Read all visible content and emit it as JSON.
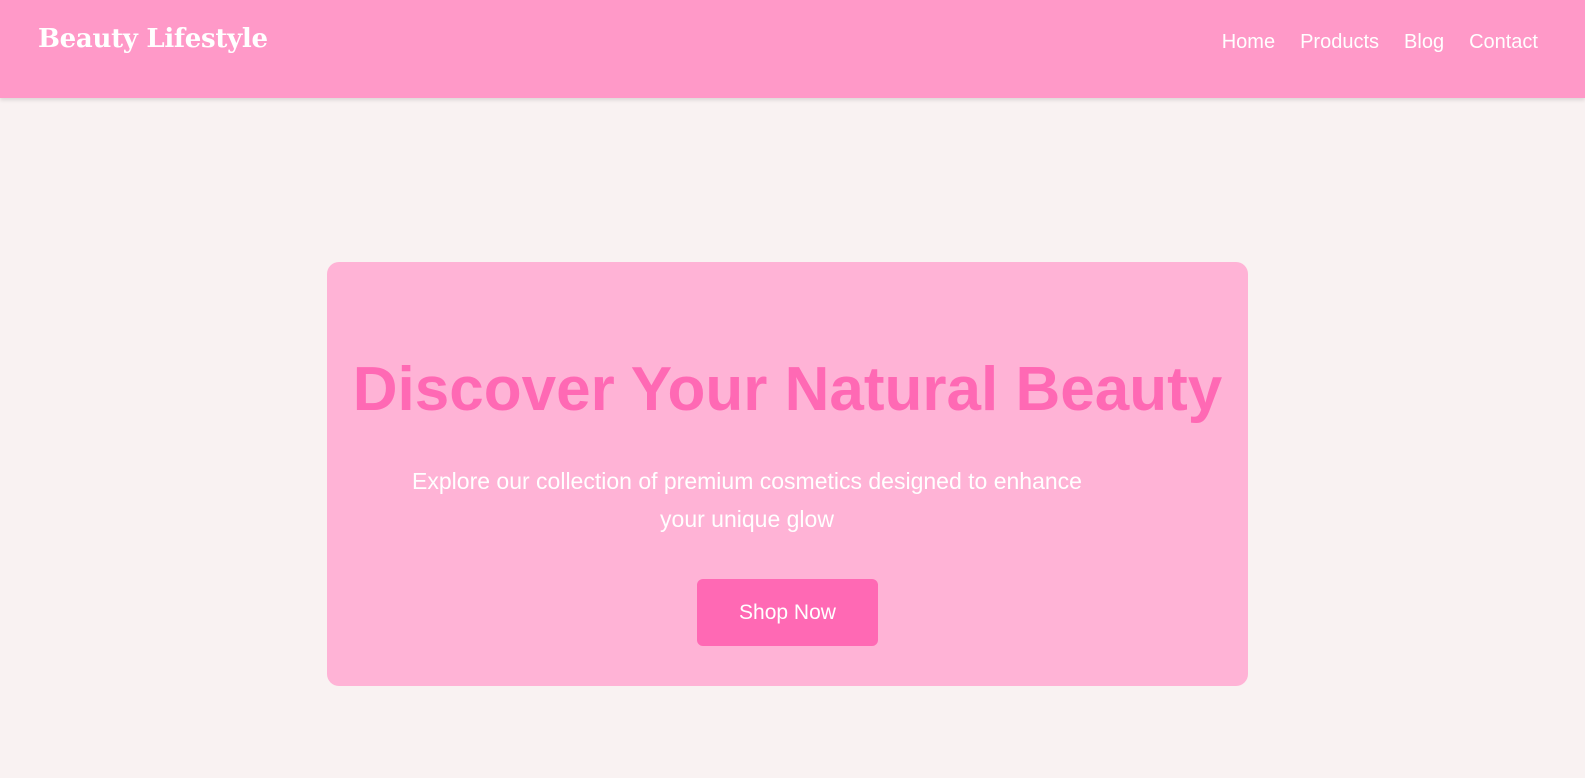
{
  "header": {
    "brand": "Beauty Lifestyle",
    "nav": [
      {
        "label": "Home"
      },
      {
        "label": "Products"
      },
      {
        "label": "Blog"
      },
      {
        "label": "Contact"
      }
    ]
  },
  "hero": {
    "title": "Discover Your Natural Beauty",
    "description": "Explore our collection of premium cosmetics designed to enhance your unique glow",
    "cta_label": "Shop Now"
  },
  "colors": {
    "header_bg": "#ff99c8",
    "page_bg": "#f9f2f2",
    "hero_bg": "#ffb3d6",
    "accent": "#ff69b4",
    "text_light": "#ffffff"
  }
}
